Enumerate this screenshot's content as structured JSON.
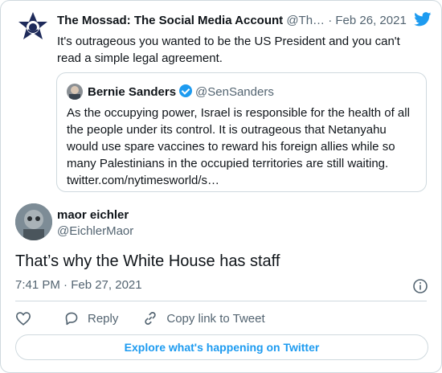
{
  "parent_tweet": {
    "author_name": "The Mossad: The Social Media Account",
    "handle": "@Th…",
    "date": "· Feb 26, 2021",
    "text": "It's outrageous you wanted to be the US President and you can't read a simple legal agreement."
  },
  "quoted_tweet": {
    "author_name": "Bernie Sanders",
    "handle": "@SenSanders",
    "text": "As the occupying power, Israel is responsible for the health of all the people under its control. It is outrageous that Netanyahu would use spare vaccines to reward his foreign allies while so many Palestinians in the occupied territories are still waiting. twitter.com/nytimesworld/s…"
  },
  "main_tweet": {
    "author_name": "maor eichler",
    "handle": "@EichlerMaor",
    "text": "That’s why the White House has staff",
    "timestamp": "7:41 PM · Feb 27, 2021"
  },
  "actions": {
    "like_icon": "heart-icon",
    "reply_label": "Reply",
    "copy_label": "Copy link to Tweet"
  },
  "explore_label": "Explore what's happening on Twitter",
  "colors": {
    "twitter_blue": "#1d9bf0",
    "text": "#0f1419",
    "secondary": "#536471",
    "border": "#cfd9de"
  }
}
